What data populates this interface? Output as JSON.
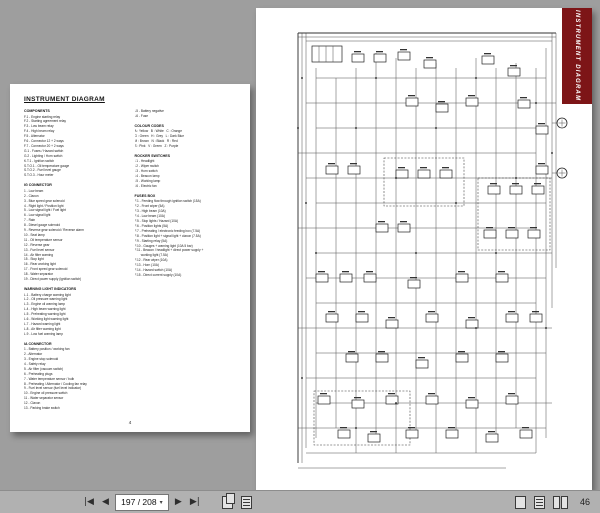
{
  "left_page": {
    "title": "INSTRUMENT DIAGRAM",
    "page_number": "4",
    "columns": [
      {
        "sections": [
          {
            "heading": "COMPONENTS",
            "items": [
              "F.1  - Engine starting relay",
              "F.2  - Starting agreement relay",
              "F.3  - Low beam relay",
              "F.4  - High beam relay",
              "F.5  - Alternator",
              "F.6  - Connector 12 + 2 ways",
              "F.7  - Connector 20 + 2 ways",
              "G.1  - Fuses / Hazard switch",
              "G.2  - Lighting / Horn switch",
              "K.T.1 - Ignition switch",
              "S.T.O.1 - Oil temperature gauge",
              "S.T.O.2 - Fuel level gauge",
              "S.T.O.3 - Hour meter"
            ]
          },
          {
            "heading": "IG CONNECTOR",
            "items": [
              "1  - Low beam",
              "2  - Claxon",
              "3  - Blue speed gear solenoid",
              "4  - Right light / Position light",
              "5  - Low signal light / Fuel light",
              "6  - Low signal light",
              "7  - Rain",
              "8  - Diesel gauge solenoid",
              "9  - Reverse gear solenoid / Reverse alarm",
              "10 - Seat lamp",
              "11 - Oil temperature sensor",
              "12 - Reverse gear",
              "13 - Fuel level sensor",
              "14 - Air filter warning",
              "15 - Stop light",
              "16 - Rear working light",
              "17 - Front speed gear solenoid",
              "18 - Water separator",
              "19 - Direct power supply (ignition switch)"
            ]
          },
          {
            "heading": "WARNING LIGHT INDICATORS",
            "items": [
              "L.1 - Battery charge warning light",
              "L.2 - Oil pressure warning light",
              "L.3 - Engine oil warning lamp",
              "L.4 - High beam warning light",
              "L.5 - Preheating warning light",
              "L.6 - Working light warning light",
              "L.7 - Hazard warning light",
              "L.8 - Air filter warning light",
              "L.9 - Low fuel warning lamp"
            ]
          },
          {
            "heading": "IA CONNECTOR",
            "items": [
              "1  - Battery position / working fan",
              "2  - Alternator",
              "3  - Engine stop solenoid",
              "4  - Safety relay",
              "5  - Air filter (vacuum switch)",
              "6  - Preheating plugs",
              "7  - Water temperature sensor / bulb",
              "8  - Preheating / Alternator / Cooling fan relay",
              "9  - Fuel level sensor (fuel level indicator)",
              "10 - Engine oil pressure switch",
              "11 - Water separator sensor",
              "12 - Claxon",
              "13 - Parking brake switch"
            ]
          }
        ]
      },
      {
        "sections": [
          {
            "heading": "",
            "items": [
              "L5  - Battery negative",
              "L6  - Fuse"
            ]
          },
          {
            "heading": "COLOUR CODES",
            "items": [
              "A : Yellow   B : White   C : Orange",
              "G : Green   H : Grey   L : Dark Blue",
              "M : Brown   N : Black   R : Red",
              "S : Pink   V : Green   Z : Purple"
            ]
          },
          {
            "heading": "ROCKER SWITCHES",
            "items": [
              "I.1 - Headlight",
              "I.2 - Wiper switch",
              "I.3 - Horn switch",
              "I.4 - Beacon lamp",
              "I.5 - Working lamp",
              "I.6 - Electric fan"
            ]
          },
          {
            "heading": "FUSES BOX",
            "items": [
              "F.1  - Feeding flow through ignition switch (15A)",
              "F.2  - Front wiper (5A)",
              "F.3  - High beam (10A)",
              "F.4  - Low beam (10A)",
              "F.5  - Stop lights / Hazard (10A)",
              "F.6  - Position lights (5A)",
              "F.7  - Preheating / electronic feeding box (7.5A)",
              "F.8  - Position light + signal light + claxon (7.5A)",
              "F.9  - Starting relay (5A)",
              "F.10 - Gauges + warning light (10A 5 bar)",
              "F.11 - Beacon / headlight + direct power supply +",
              "       working light (7.5A)",
              "F.12 - Rear wiper (10A)",
              "F.13 - Horn (10A)",
              "F.14 - Hazard switch (10A)",
              "F.15 - Direct current supply (10A)"
            ]
          }
        ]
      }
    ]
  },
  "right_page": {
    "side_label": "INSTRUMENT DIAGRAM"
  },
  "toolbar": {
    "first_label": "|◀",
    "prev_label": "◀",
    "next_label": "▶",
    "last_label": "▶|",
    "page_value": "197 / 208",
    "page_select_arrow": "▾",
    "zoom_value": "46"
  },
  "colors": {
    "band_maroon": "#7d1517",
    "canvas_gray": "#9e9e9e",
    "toolbar_gray": "#b1b1b1"
  }
}
